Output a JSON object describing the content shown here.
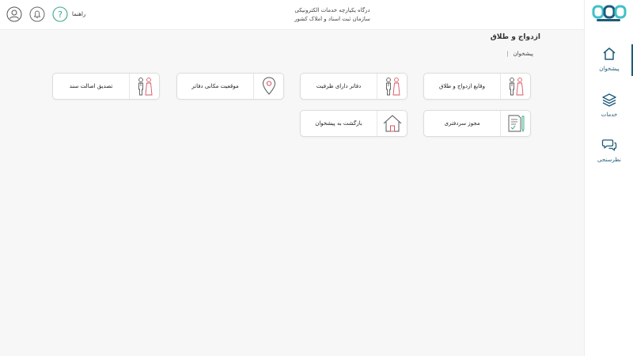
{
  "header": {
    "title_line1": "درگاه یکپارچه خدمات الکترونیکی",
    "title_line2": "سازمان ثبت اسناد و املاک کشور",
    "help_label": "راهنما",
    "help_icon": "question-icon",
    "bell_icon": "bell-icon",
    "user_icon": "user-icon"
  },
  "sidebar": {
    "logo": "logo-icon",
    "items": [
      {
        "label": "پیشخوان",
        "icon": "home-icon",
        "active": true
      },
      {
        "label": "خدمات",
        "icon": "layers-icon",
        "active": false
      },
      {
        "label": "نظرسنجی",
        "icon": "chat-icon",
        "active": false
      }
    ]
  },
  "page": {
    "title": "ازدواج و طلاق",
    "breadcrumb": [
      "پیشخوان",
      "|"
    ]
  },
  "cards": [
    {
      "label": "وقایع ازدواج و طلاق",
      "icon": "couple-icon"
    },
    {
      "label": "دفاتر دارای ظرفیت",
      "icon": "couple-icon"
    },
    {
      "label": "موقعیت مکانی دفاتر",
      "icon": "location-pin-icon"
    },
    {
      "label": "تصدیق اصالت سند",
      "icon": "couple-icon"
    },
    {
      "label": "مجوز سردفتری",
      "icon": "document-pen-icon"
    },
    {
      "label": "بازگشت به پیشخوان",
      "icon": "house-icon"
    }
  ],
  "colors": {
    "brand": "#1f5a7a",
    "accent_teal": "#3fc1c9",
    "icon_red": "#d9535f",
    "help_green": "#3aa88a"
  }
}
